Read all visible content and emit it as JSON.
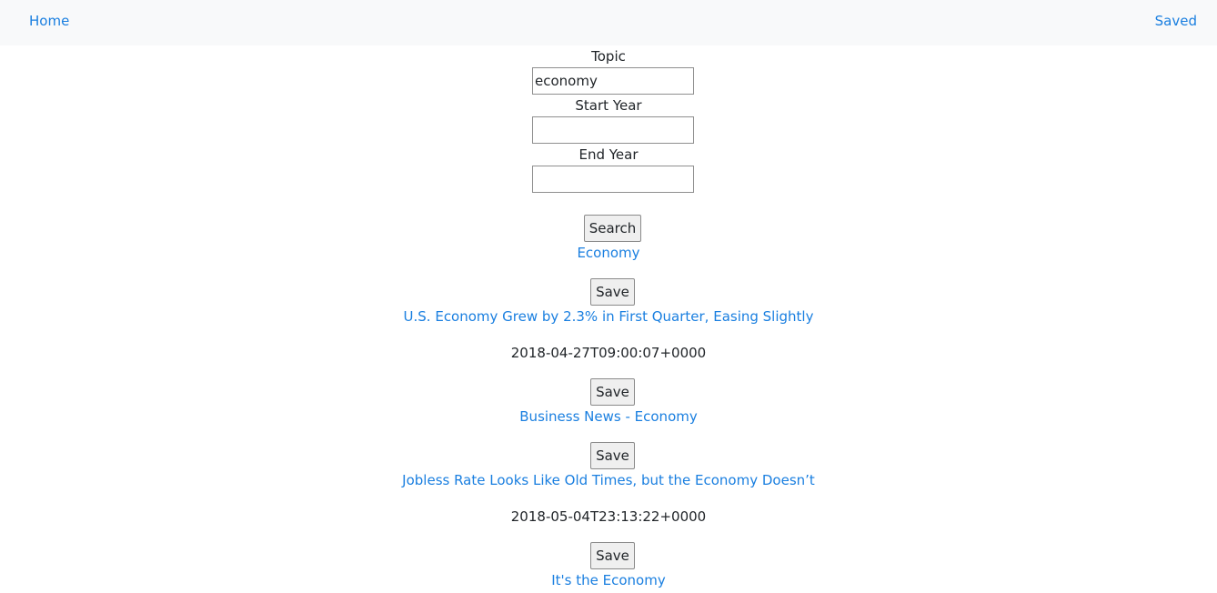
{
  "nav": {
    "home": "Home",
    "saved": "Saved"
  },
  "form": {
    "topic_label": "Topic",
    "topic_value": "economy",
    "start_label": "Start Year",
    "start_value": "",
    "end_label": "End Year",
    "end_value": "",
    "search_label": "Search"
  },
  "results": [
    {
      "title": "Economy",
      "date": "",
      "save_label": "Save"
    },
    {
      "title": "U.S. Economy Grew by 2.3% in First Quarter, Easing Slightly",
      "date": "2018-04-27T09:00:07+0000",
      "save_label": "Save"
    },
    {
      "title": "Business News - Economy",
      "date": "",
      "save_label": "Save"
    },
    {
      "title": "Jobless Rate Looks Like Old Times, but the Economy Doesn’t",
      "date": "2018-05-04T23:13:22+0000",
      "save_label": "Save"
    },
    {
      "title": "It's the Economy",
      "date": ""
    }
  ]
}
